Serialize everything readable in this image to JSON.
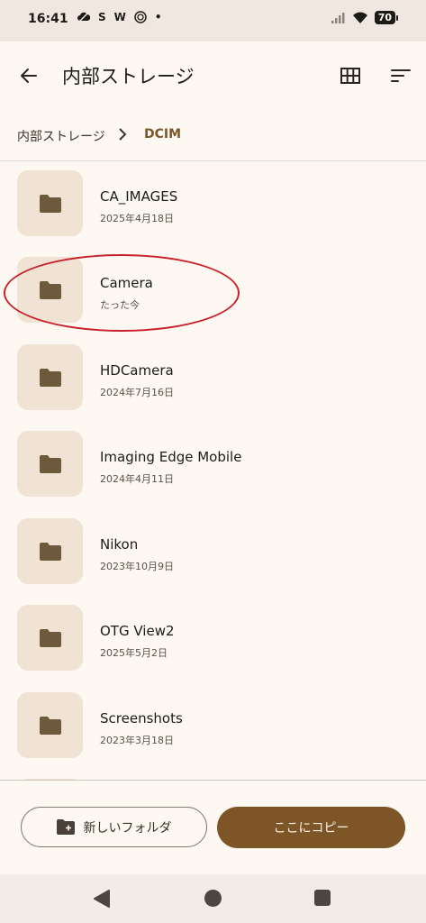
{
  "status_bar": {
    "time": "16:41",
    "left_icons": [
      "cloud-icon",
      "S",
      "W",
      "nfc-icon",
      "•"
    ],
    "battery": "70"
  },
  "toolbar": {
    "title": "内部ストレージ"
  },
  "breadcrumb": {
    "root": "内部ストレージ",
    "current": "DCIM"
  },
  "folders": [
    {
      "name": "CA_IMAGES",
      "date": "2025年4月18日"
    },
    {
      "name": "Camera",
      "date": "たった今"
    },
    {
      "name": "HDCamera",
      "date": "2024年7月16日"
    },
    {
      "name": "Imaging Edge Mobile",
      "date": "2024年4月11日"
    },
    {
      "name": "Nikon",
      "date": "2023年10月9日"
    },
    {
      "name": "OTG View2",
      "date": "2025年5月2日"
    },
    {
      "name": "Screenshots",
      "date": "2023年3月18日"
    }
  ],
  "actions": {
    "new_folder": "新しいフォルダ",
    "copy_here": "ここにコピー"
  },
  "colors": {
    "accent": "#7e5527",
    "background": "#fdf8f2",
    "folder_tile": "#f1e3d3",
    "annotation": "#c8202b"
  }
}
